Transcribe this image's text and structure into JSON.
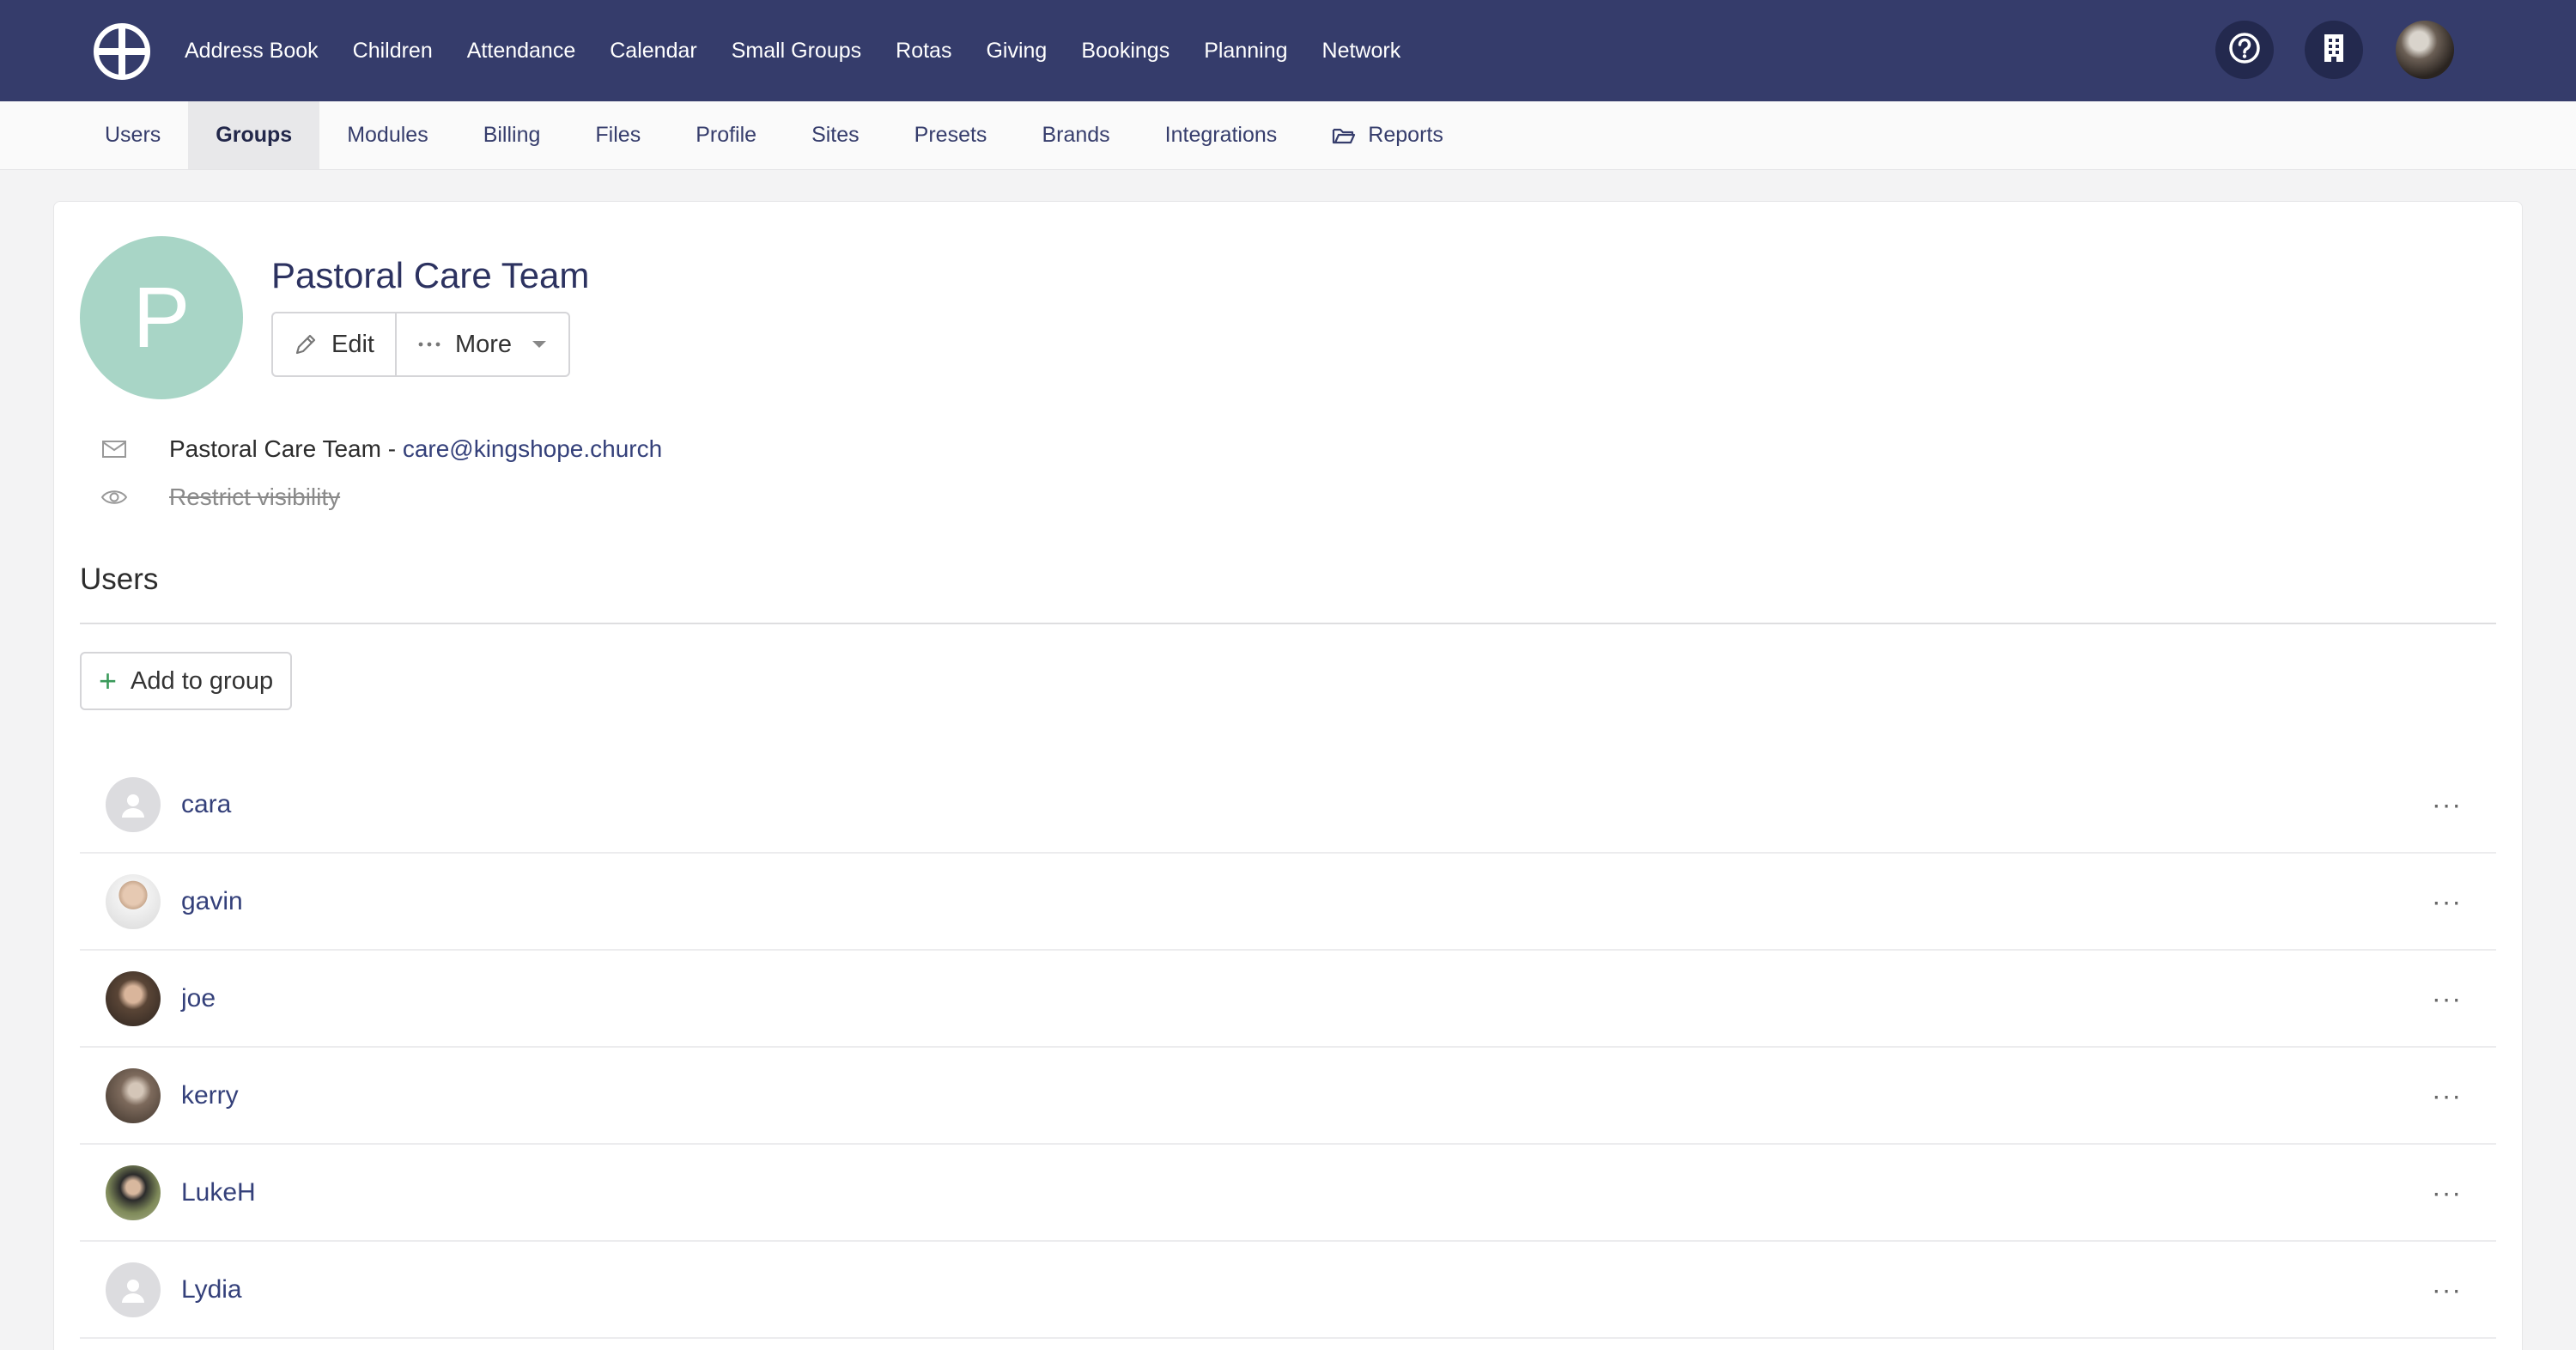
{
  "topnav": {
    "logo_icon": "globe-cross-logo",
    "items": [
      "Address Book",
      "Children",
      "Attendance",
      "Calendar",
      "Small Groups",
      "Rotas",
      "Giving",
      "Bookings",
      "Planning",
      "Network"
    ],
    "help_icon": "help-circle-icon",
    "org_icon": "building-icon",
    "avatar_icon": "user-avatar"
  },
  "subnav": {
    "tabs": [
      "Users",
      "Groups",
      "Modules",
      "Billing",
      "Files",
      "Profile",
      "Sites",
      "Presets",
      "Brands",
      "Integrations",
      "Reports"
    ],
    "active": "Groups"
  },
  "group": {
    "initial": "P",
    "title": "Pastoral Care Team",
    "edit_label": "Edit",
    "more_label": "More",
    "email_prefix": "Pastoral Care Team - ",
    "email": "care@kingshope.church",
    "visibility": "Restrict visibility"
  },
  "users": {
    "section_title": "Users",
    "add_label": "Add to group",
    "list": [
      {
        "name": "cara",
        "avatar": "default"
      },
      {
        "name": "gavin",
        "avatar": "photo"
      },
      {
        "name": "joe",
        "avatar": "photo"
      },
      {
        "name": "kerry",
        "avatar": "photo"
      },
      {
        "name": "LukeH",
        "avatar": "photo"
      },
      {
        "name": "Lydia",
        "avatar": "default"
      }
    ],
    "row_menu": "···"
  },
  "colors": {
    "topbar": "#353c6b",
    "accent_text": "#34407a",
    "group_avatar": "#a8d5c6"
  }
}
